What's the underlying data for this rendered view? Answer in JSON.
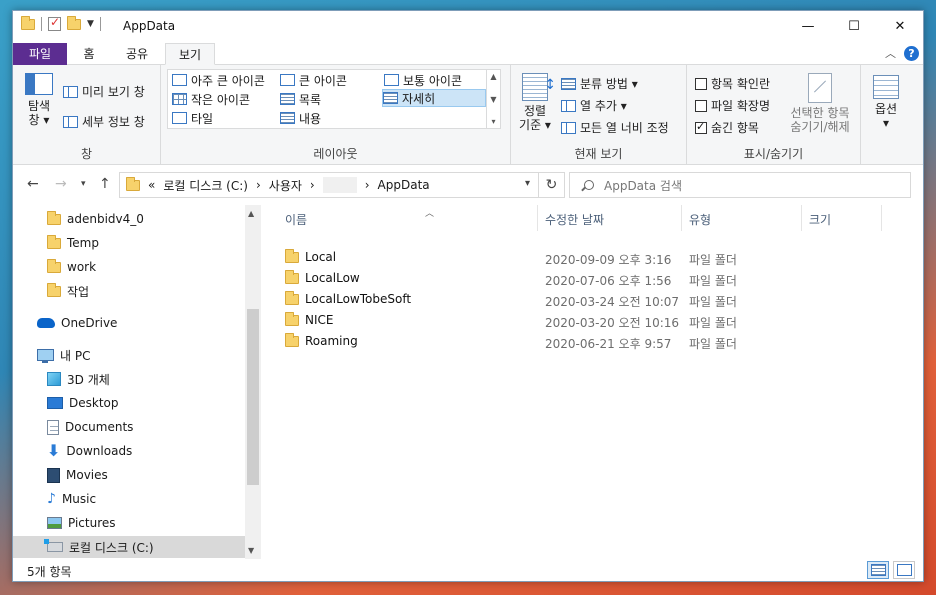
{
  "window": {
    "title": "AppData"
  },
  "window_controls": {
    "minimize": "—",
    "maximize": "☐",
    "close": "✕"
  },
  "ribbon_tabs": {
    "file": "파일",
    "home": "홈",
    "share": "공유",
    "view": "보기"
  },
  "ribbon": {
    "pane": {
      "nav_pane_label_1": "탐색",
      "nav_pane_label_2": "창 ▾",
      "preview_pane": "미리 보기 창",
      "details_pane": "세부 정보 창",
      "group_label": "창"
    },
    "layout": {
      "extra_large_icons": "아주 큰 아이콘",
      "large_icons": "큰 아이콘",
      "medium_icons": "보통 아이콘",
      "small_icons": "작은 아이콘",
      "list": "목록",
      "details": "자세히",
      "tiles": "타일",
      "content": "내용",
      "group_label": "레이아웃"
    },
    "current_view": {
      "sort_by_1": "정렬",
      "sort_by_2": "기준 ▾",
      "group_by": "분류 방법 ▾",
      "add_columns": "열 추가 ▾",
      "size_all_columns": "모든 열 너비 조정",
      "group_label": "현재 보기"
    },
    "show_hide": {
      "item_check_boxes": "항목 확인란",
      "file_name_extensions": "파일 확장명",
      "hidden_items": "숨긴 항목",
      "hide_selected_1": "선택한 항목",
      "hide_selected_2": "숨기기/해제",
      "group_label": "표시/숨기기"
    },
    "options": {
      "label": "옵션",
      "arrow": "▾"
    }
  },
  "address": {
    "prefix": "«",
    "crumbs": [
      "로컬 디스크 (C:)",
      "사용자",
      "AppData"
    ],
    "separator": "›"
  },
  "search": {
    "placeholder": "AppData 검색"
  },
  "nav_pane": {
    "items": [
      {
        "label": "adenbidv4_0",
        "icon": "folder-icon"
      },
      {
        "label": "Temp",
        "icon": "folder-icon"
      },
      {
        "label": "work",
        "icon": "folder-icon"
      },
      {
        "label": "작업",
        "icon": "folder-icon"
      },
      {
        "label": "OneDrive",
        "icon": "onedrive-icon"
      },
      {
        "label": "내 PC",
        "icon": "pc-icon"
      },
      {
        "label": "3D 개체",
        "icon": "3d-objects-icon"
      },
      {
        "label": "Desktop",
        "icon": "desktop-icon"
      },
      {
        "label": "Documents",
        "icon": "documents-icon"
      },
      {
        "label": "Downloads",
        "icon": "downloads-icon"
      },
      {
        "label": "Movies",
        "icon": "movies-icon"
      },
      {
        "label": "Music",
        "icon": "music-icon"
      },
      {
        "label": "Pictures",
        "icon": "pictures-icon"
      },
      {
        "label": "로컬 디스크 (C:)",
        "icon": "drive-icon"
      }
    ]
  },
  "columns": {
    "name": "이름",
    "date": "수정한 날짜",
    "type": "유형",
    "size": "크기"
  },
  "files": [
    {
      "name": "Local",
      "date": "2020-09-09 오후 3:16",
      "type": "파일 폴더"
    },
    {
      "name": "LocalLow",
      "date": "2020-07-06 오후 1:56",
      "type": "파일 폴더"
    },
    {
      "name": "LocalLowTobeSoft",
      "date": "2020-03-24 오전 10:07",
      "type": "파일 폴더"
    },
    {
      "name": "NICE",
      "date": "2020-03-20 오전 10:16",
      "type": "파일 폴더"
    },
    {
      "name": "Roaming",
      "date": "2020-06-21 오후 9:57",
      "type": "파일 폴더"
    }
  ],
  "status": {
    "item_count": "5개 항목"
  }
}
